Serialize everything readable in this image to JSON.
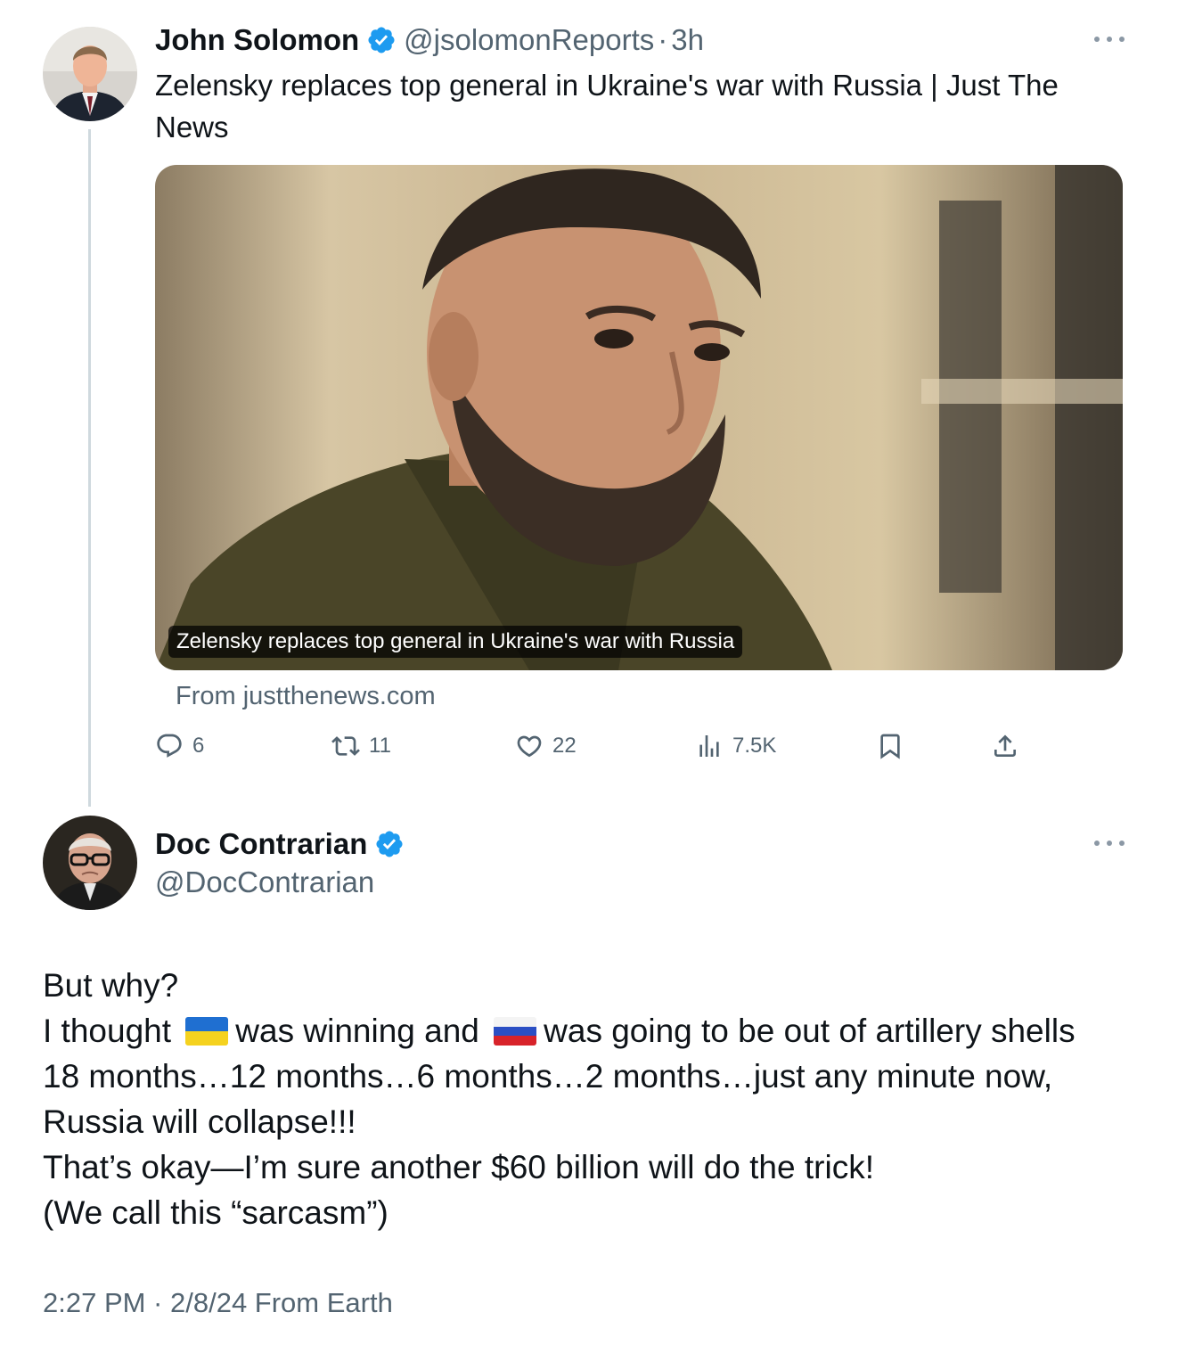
{
  "tweet1": {
    "name": "John Solomon",
    "handle": "@jsolomonReports",
    "separator": "·",
    "time": "3h",
    "text": "Zelensky replaces top general in Ukraine's war with Russia  | Just The News",
    "card": {
      "caption": "Zelensky replaces top general in Ukraine's war with Russia",
      "source": "From justthenews.com"
    },
    "actions": {
      "replies": "6",
      "reposts": "11",
      "likes": "22",
      "views": "7.5K"
    }
  },
  "tweet2": {
    "name": "Doc Contrarian",
    "handle": "@DocContrarian",
    "lines": {
      "l1": "But why?",
      "l2a": "I thought",
      "l2b": "was winning and",
      "l2c": "was going to be out of artillery shells",
      "l3": "18 months…12 months…6 months…2 months…just any minute now,",
      "l4": "Russia will collapse!!!",
      "l5": "That’s okay—I’m sure another $60 billion will do the trick!",
      "l6": "(We call this “sarcasm”)"
    },
    "footer": "2:27 PM · 2/8/24 From Earth"
  },
  "colors": {
    "verified": "#1d9bf0",
    "secondary_text": "#536471",
    "thread_line": "#cfd9de"
  },
  "icons": [
    "verified-badge-icon",
    "more-icon",
    "reply-icon",
    "repost-icon",
    "like-icon",
    "views-icon",
    "bookmark-icon",
    "share-icon",
    "ukraine-flag-icon",
    "russia-flag-icon"
  ]
}
